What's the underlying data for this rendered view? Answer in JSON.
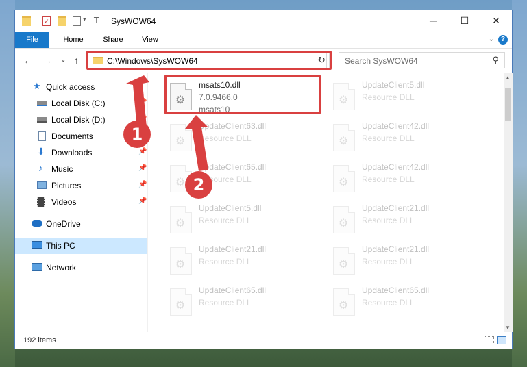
{
  "window": {
    "title": "SysWOW64",
    "controls": {
      "minimize": "─",
      "maximize": "☐",
      "close": "✕"
    }
  },
  "ribbon": {
    "tabs": [
      "File",
      "Home",
      "Share",
      "View"
    ],
    "help": "?",
    "collapse": "⌄"
  },
  "nav": {
    "back": "←",
    "forward": "→",
    "recent": "⌄",
    "up": "↑",
    "address": "C:\\Windows\\SysWOW64",
    "address_dropdown": "⌄",
    "refresh": "↻",
    "search_placeholder": "Search SysWOW64",
    "search_icon": "⚲"
  },
  "sidebar": {
    "items": [
      {
        "label": "Quick access",
        "icon": "star-icon",
        "pinned": false
      },
      {
        "label": "Local Disk (C:)",
        "icon": "drive-icon",
        "pinned": true
      },
      {
        "label": "Local Disk (D:)",
        "icon": "drive-icon",
        "pinned": true
      },
      {
        "label": "Documents",
        "icon": "document-icon",
        "pinned": true
      },
      {
        "label": "Downloads",
        "icon": "download-icon",
        "pinned": true
      },
      {
        "label": "Music",
        "icon": "music-icon",
        "pinned": true
      },
      {
        "label": "Pictures",
        "icon": "pictures-icon",
        "pinned": true
      },
      {
        "label": "Videos",
        "icon": "video-icon",
        "pinned": true
      },
      {
        "label": "OneDrive",
        "icon": "cloud-icon",
        "pinned": false
      },
      {
        "label": "This PC",
        "icon": "computer-icon",
        "pinned": false,
        "selected": true
      },
      {
        "label": "Network",
        "icon": "network-icon",
        "pinned": false
      }
    ],
    "pin_glyph": "📌"
  },
  "files": {
    "highlighted": {
      "name": "msats10.dll",
      "version": "7.0.9466.0",
      "description": "msats10"
    },
    "left_column": [
      {
        "name": "UpdateClient63.dll",
        "type": "Resource DLL"
      },
      {
        "name": "UpdateClient65.dll",
        "type": "Resource DLL"
      },
      {
        "name": "UpdateClient5.dll",
        "type": "Resource DLL"
      },
      {
        "name": "UpdateClient21.dll",
        "type": "Resource DLL"
      },
      {
        "name": "UpdateClient65.dll",
        "type": "Resource DLL"
      }
    ],
    "right_column": [
      {
        "name": "UpdateClient5.dll",
        "type": "Resource DLL"
      },
      {
        "name": "UpdateClient42.dll",
        "type": "Resource DLL"
      },
      {
        "name": "UpdateClient42.dll",
        "type": "Resource DLL"
      },
      {
        "name": "UpdateClient21.dll",
        "type": "Resource DLL"
      },
      {
        "name": "UpdateClient21.dll",
        "type": "Resource DLL"
      },
      {
        "name": "UpdateClient65.dll",
        "type": "Resource DLL"
      }
    ]
  },
  "status": {
    "count": "192 items"
  },
  "annotations": {
    "marker1": "1",
    "marker2": "2",
    "color": "#d94040"
  }
}
